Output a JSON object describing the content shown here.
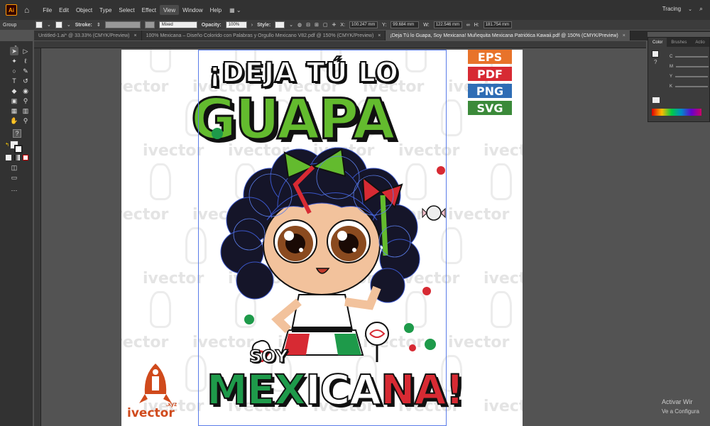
{
  "menubar": {
    "items": [
      "File",
      "Edit",
      "Object",
      "Type",
      "Select",
      "Effect",
      "View",
      "Window",
      "Help"
    ],
    "active_item": "View",
    "workspace": "Tracing",
    "logo": "Ai"
  },
  "controlbar": {
    "selection_type": "Group",
    "stroke_label": "Stroke:",
    "brush_value": "Mixed",
    "opacity_label": "Opacity:",
    "opacity_value": "100%",
    "style_label": "Style:",
    "x_label": "X:",
    "x_value": "100.247 mm",
    "y_label": "Y:",
    "y_value": "99.684 mm",
    "w_label": "W:",
    "w_value": "122.546 mm",
    "h_label": "H:",
    "h_value": "181.754 mm"
  },
  "tabs": [
    {
      "label": "Untitled-1.ai* @ 33.33% (CMYK/Preview)",
      "active": false
    },
    {
      "label": "100% Mexicana – Diseño Colorido con Palabras y Orgullo Mexicano V82.pdf @ 150% (CMYK/Preview)",
      "active": false
    },
    {
      "label": "¡Deja Tú lo Guapa, Soy Mexicana! Muñequita Mexicana Patriótica Kawaii.pdf @ 150% (CMYK/Preview)",
      "active": true
    }
  ],
  "artwork": {
    "title_line1": "¡DEJA TÚ LO",
    "title_line2": "GUAPA",
    "soy": "SOY",
    "mex_part1": "MEX",
    "mex_part2": "ICA",
    "mex_part3": "NA!",
    "badges": [
      {
        "label": "EPS",
        "color": "#e8732a"
      },
      {
        "label": "PDF",
        "color": "#d72a33"
      },
      {
        "label": "PNG",
        "color": "#2f6db5"
      },
      {
        "label": "SVG",
        "color": "#3b8a3a"
      }
    ],
    "watermark": "ivector",
    "logo_text": "ivector",
    "logo_suffix": ".xyz"
  },
  "color_panel": {
    "tabs": [
      "Color",
      "Brushes",
      "Actio"
    ],
    "sliders": [
      "C",
      "M",
      "Y",
      "K"
    ]
  },
  "activation": {
    "line1": "Activar Wir",
    "line2": "Ve a Configura"
  },
  "colors": {
    "green": "#63bb2e",
    "dark_green": "#1e9a4a",
    "red": "#d72a33",
    "selection": "#5a7ce8"
  }
}
